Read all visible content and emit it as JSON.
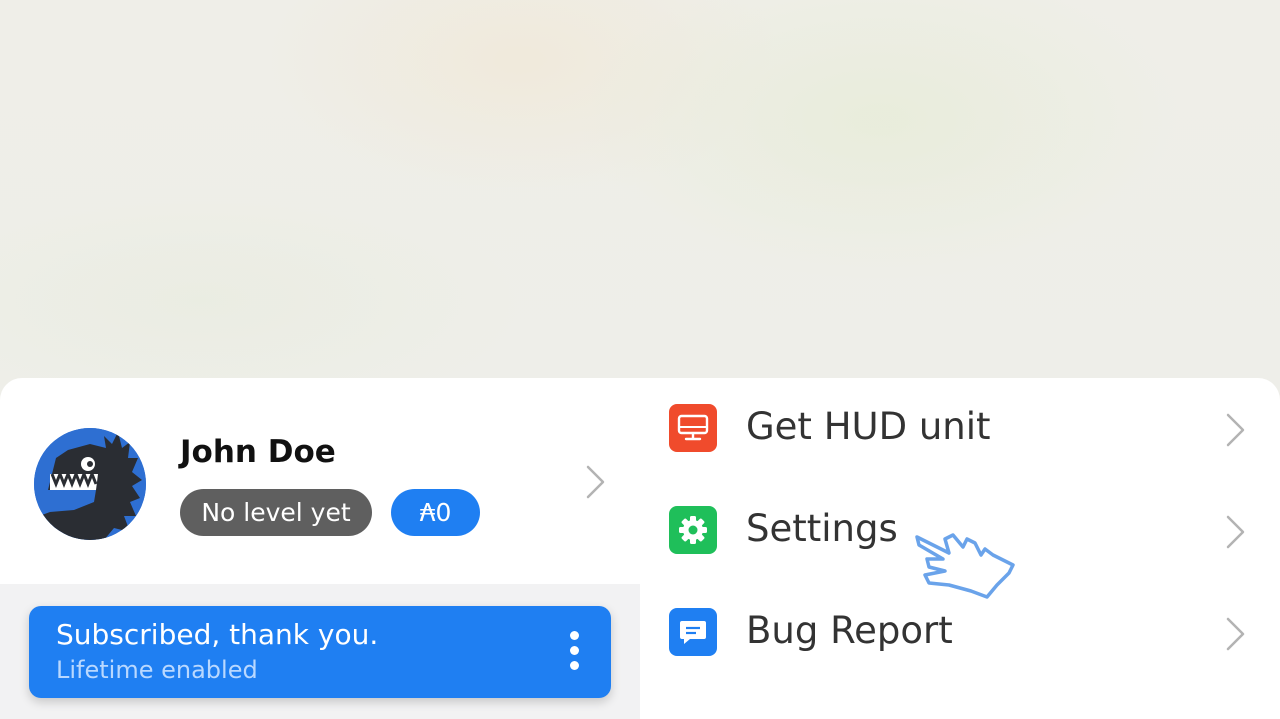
{
  "profile": {
    "name": "John Doe",
    "level": "No level yet",
    "coins": "₳0",
    "avatar_icon": "godzilla-avatar"
  },
  "subscription": {
    "title": "Subscribed, thank you.",
    "subtitle": "Lifetime enabled"
  },
  "menu": [
    {
      "label": "Get HUD unit",
      "icon": "monitor-icon",
      "color": "#f04b2c"
    },
    {
      "label": "Settings",
      "icon": "gear-icon",
      "color": "#1fbf5a"
    },
    {
      "label": "Bug Report",
      "icon": "chat-bubble-icon",
      "color": "#1f7ff2"
    }
  ],
  "colors": {
    "accent": "#1f7ff2",
    "level_pill": "#5f5f5f"
  }
}
